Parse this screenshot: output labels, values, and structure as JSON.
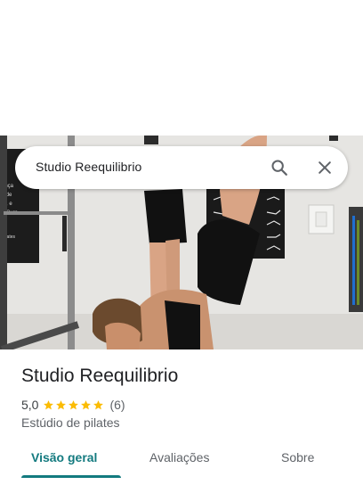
{
  "search": {
    "query": "Studio Reequilibrio",
    "search_icon": "search-icon",
    "close_icon": "close-icon"
  },
  "photo": {
    "poster_left_lines": [
      "ança",
      "s de",
      "to, e",
      "o Cura",
      "Pilates"
    ]
  },
  "place": {
    "name": "Studio Reequilibrio",
    "rating": "5,0",
    "stars": 5,
    "review_count": "(6)",
    "category": "Estúdio de pilates"
  },
  "tabs": [
    {
      "label": "Visão geral",
      "active": true
    },
    {
      "label": "Avaliações",
      "active": false
    },
    {
      "label": "Sobre",
      "active": false
    }
  ],
  "colors": {
    "accent": "#137a7f",
    "star": "#fbbc04"
  }
}
